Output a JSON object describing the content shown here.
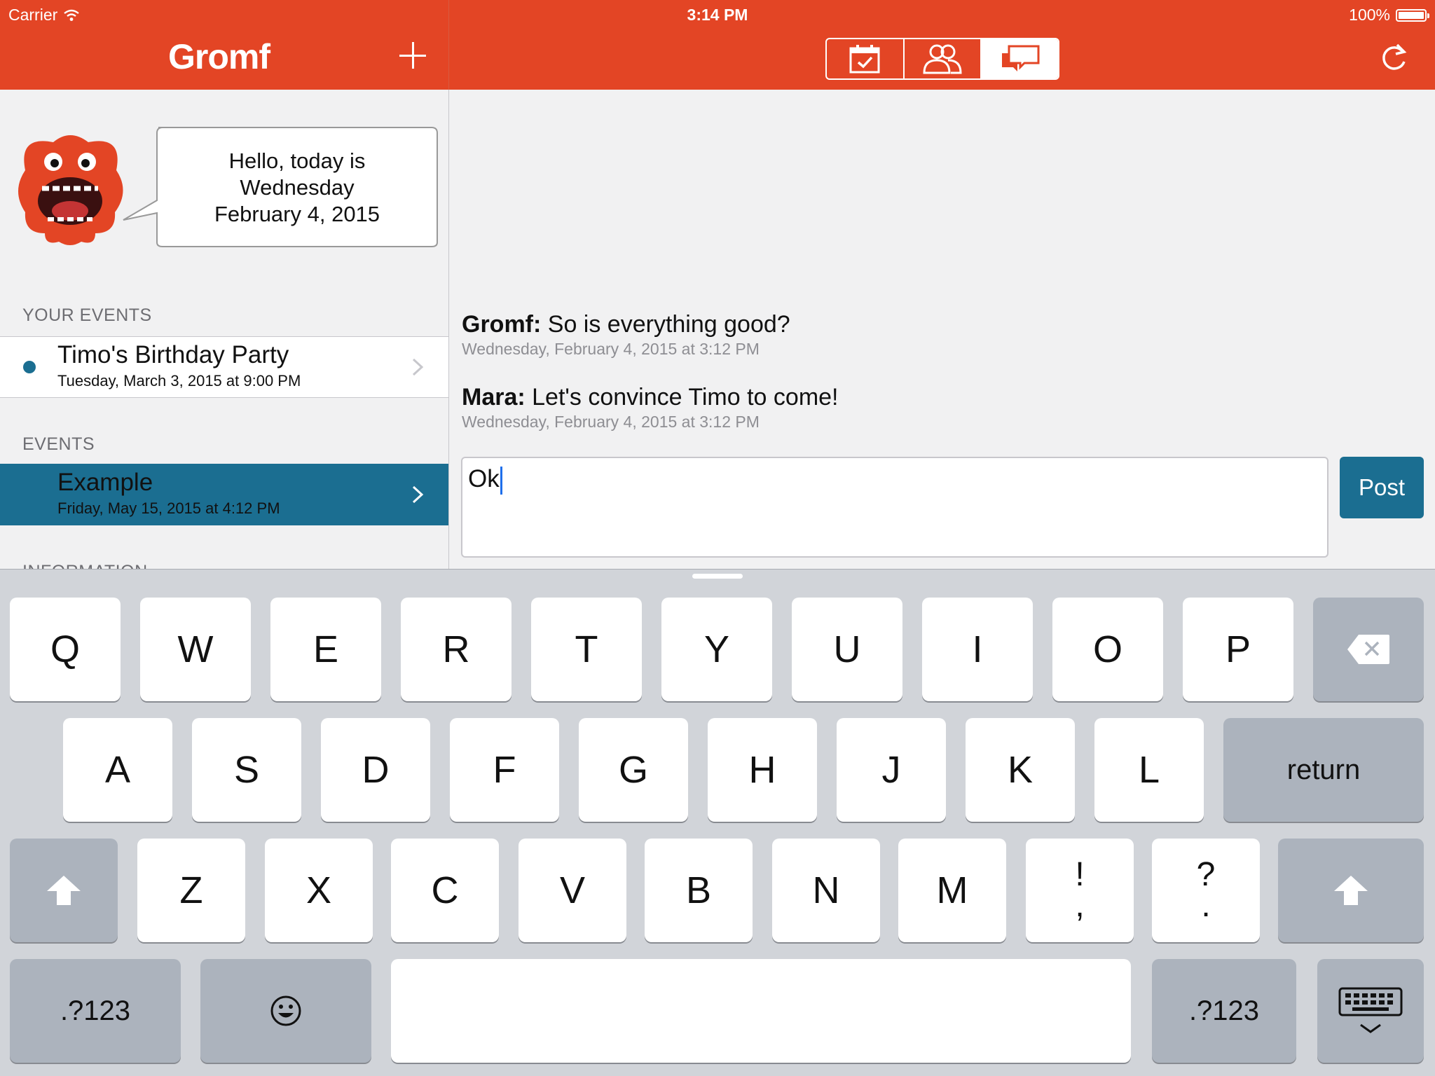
{
  "status_bar": {
    "carrier": "Carrier",
    "time": "3:14 PM",
    "battery": "100%",
    "battery_level": 1.0
  },
  "app": {
    "title": "Gromf",
    "accent_color": "#e34525",
    "selection_color": "#1b6e91"
  },
  "segments": [
    {
      "icon": "calendar-check-icon",
      "active": false
    },
    {
      "icon": "people-icon",
      "active": false
    },
    {
      "icon": "chat-bubbles-icon",
      "active": true
    }
  ],
  "greeting": {
    "line1": "Hello, today is",
    "line2": "Wednesday",
    "line3": "February 4, 2015"
  },
  "sidebar": {
    "your_events_header": "YOUR EVENTS",
    "your_events": [
      {
        "title": "Timo's Birthday Party",
        "subtitle": "Tuesday, March 3, 2015 at 9:00 PM"
      }
    ],
    "events_header": "EVENTS",
    "events": [
      {
        "title": "Example",
        "subtitle": "Friday, May 15, 2015 at 4:12 PM",
        "selected": true
      }
    ],
    "information_header": "INFORMATION"
  },
  "chat": {
    "messages": [
      {
        "author": "Gromf:",
        "text": " So is everything good?",
        "timestamp": "Wednesday, February 4, 2015 at 3:12 PM"
      },
      {
        "author": "Mara:",
        "text": " Let's convince Timo to come!",
        "timestamp": "Wednesday, February 4, 2015 at 3:12 PM"
      }
    ],
    "input_value": "Ok",
    "post_label": "Post"
  },
  "keyboard": {
    "row1": [
      "Q",
      "W",
      "E",
      "R",
      "T",
      "Y",
      "U",
      "I",
      "O",
      "P"
    ],
    "row2": [
      "A",
      "S",
      "D",
      "F",
      "G",
      "H",
      "J",
      "K",
      "L"
    ],
    "row3": [
      "Z",
      "X",
      "C",
      "V",
      "B",
      "N",
      "M"
    ],
    "return_label": "return",
    "numbers_label": ".?123",
    "punct1_top": "!",
    "punct1_bottom": ",",
    "punct2_top": "?",
    "punct2_bottom": "."
  }
}
